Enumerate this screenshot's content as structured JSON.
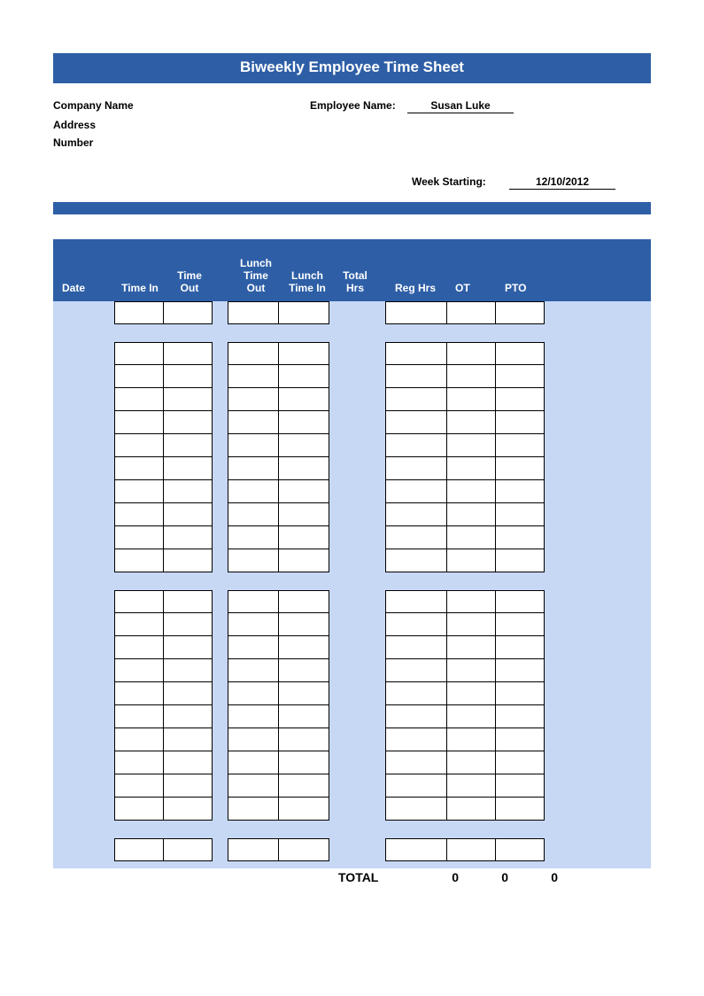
{
  "title": "Biweekly Employee Time Sheet",
  "labels": {
    "company_name": "Company Name",
    "address": "Address",
    "number": "Number",
    "employee_name": "Employee Name:",
    "week_starting": "Week Starting:"
  },
  "values": {
    "employee_name": "Susan Luke",
    "week_starting": "12/10/2012"
  },
  "columns": {
    "date": "Date",
    "time_in": "Time In",
    "time_out": "Time Out",
    "lunch_out": "Lunch Time Out",
    "lunch_in": "Lunch Time In",
    "total_hrs": "Total Hrs",
    "reg_hrs": "Reg Hrs",
    "ot": "OT",
    "pto": "PTO"
  },
  "totals": {
    "label": "TOTAL",
    "reg": "0",
    "ot": "0",
    "pto": "0"
  }
}
